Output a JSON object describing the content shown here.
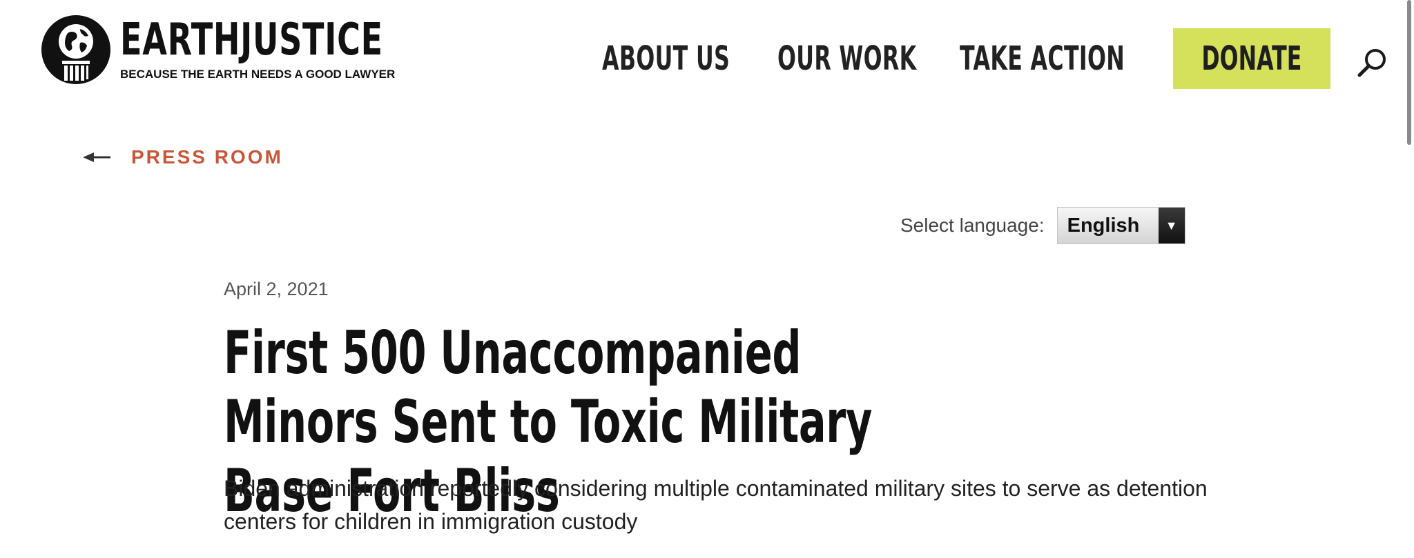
{
  "header": {
    "logo": {
      "name": "EARTHJUSTICE",
      "tagline": "BECAUSE THE EARTH NEEDS A GOOD LAWYER",
      "icon": "globe-pillar-icon"
    },
    "nav": [
      {
        "label": "ABOUT US",
        "icon": "chevron-down-icon"
      },
      {
        "label": "OUR WORK",
        "icon": "chevron-down-icon"
      },
      {
        "label": "TAKE ACTION",
        "icon": "chevron-down-icon"
      }
    ],
    "donate_label": "DONATE",
    "search_icon": "search-icon",
    "colors": {
      "donate_bg": "#d5e05b",
      "accent": "#c8573a"
    }
  },
  "back_link": {
    "label": "PRESS ROOM",
    "icon": "arrow-left-icon"
  },
  "language": {
    "label": "Select language:",
    "selected": "English"
  },
  "article": {
    "date": "April 2, 2021",
    "title": "First 500 Unaccompanied Minors Sent to Toxic Military Base Fort Bliss",
    "subtitle": "Biden administration reportedly considering multiple contaminated military sites to serve as detention centers for children in immigration custody"
  }
}
